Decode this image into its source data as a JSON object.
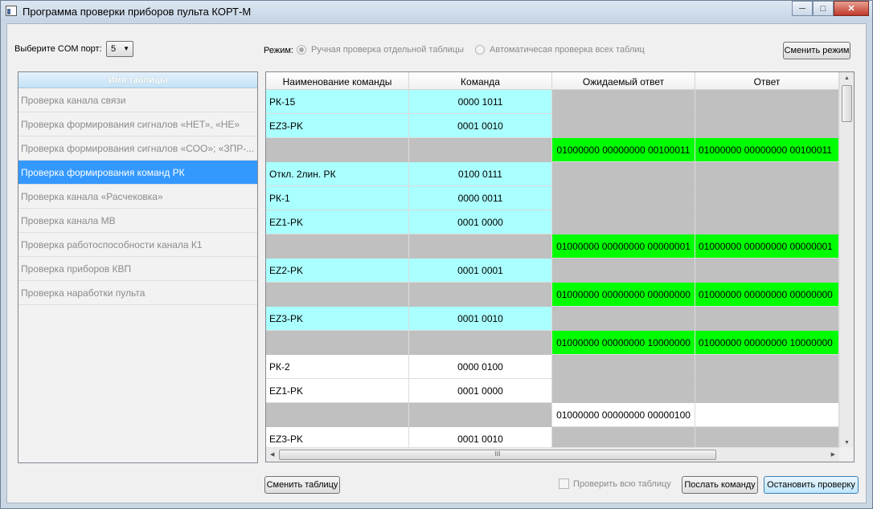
{
  "window": {
    "title": "Программа проверки приборов пульта КОРТ-М"
  },
  "com": {
    "label": "Выберите COM порт:",
    "value": "5"
  },
  "mode": {
    "label": "Режим:",
    "manual": "Ручная проверка отдельной таблицы",
    "auto": "Автоматичесая проверка всех таблиц",
    "selected": "manual"
  },
  "buttons": {
    "switch_mode": "Сменить режим",
    "switch_table": "Сменить таблицу",
    "send_command": "Послать команду",
    "stop_check": "Остановить проверку"
  },
  "check_all": {
    "label": "Проверить всю таблицу",
    "checked": false
  },
  "tables": {
    "header": "Имя таблицы",
    "items": [
      {
        "label": "Проверка канала связи"
      },
      {
        "label": "Проверка формирования сигналов «НЕТ», «НЕ»"
      },
      {
        "label": "Проверка формирования сигналов «СОО»; «ЗПР-..."
      },
      {
        "label": "Проверка формирования команд РК",
        "selected": true
      },
      {
        "label": "Проверка канала «Расчековка»"
      },
      {
        "label": "Проверка канала МВ"
      },
      {
        "label": "Проверка работоспособности канала К1"
      },
      {
        "label": "Проверка приборов КВП"
      },
      {
        "label": "Проверка наработки пульта"
      }
    ]
  },
  "grid": {
    "columns": [
      "Наименование команды",
      "Команда",
      "Ожидаемый ответ",
      "Ответ"
    ],
    "rows": [
      {
        "name": "РК-15",
        "cmd": "0000 1011",
        "expected": "",
        "answer": "",
        "style": "cmd"
      },
      {
        "name": "EZ3-PK",
        "cmd": "0001 0010",
        "expected": "",
        "answer": "",
        "style": "cmd"
      },
      {
        "name": "",
        "cmd": "",
        "expected": "01000000  00000000  00100011",
        "answer": "01000000  00000000  00100011",
        "style": "resp"
      },
      {
        "name": "Откл. 2лин. РК",
        "cmd": "0100 0111",
        "expected": "",
        "answer": "",
        "style": "cmd"
      },
      {
        "name": "РК-1",
        "cmd": "0000 0011",
        "expected": "",
        "answer": "",
        "style": "cmd"
      },
      {
        "name": "EZ1-PK",
        "cmd": "0001 0000",
        "expected": "",
        "answer": "",
        "style": "cmd"
      },
      {
        "name": "",
        "cmd": "",
        "expected": "01000000  00000000  00000001",
        "answer": "01000000  00000000  00000001",
        "style": "resp"
      },
      {
        "name": "EZ2-PK",
        "cmd": "0001 0001",
        "expected": "",
        "answer": "",
        "style": "cmd"
      },
      {
        "name": "",
        "cmd": "",
        "expected": "01000000  00000000  00000000",
        "answer": "01000000  00000000  00000000",
        "style": "resp"
      },
      {
        "name": "EZ3-PK",
        "cmd": "0001 0010",
        "expected": "",
        "answer": "",
        "style": "cmd"
      },
      {
        "name": "",
        "cmd": "",
        "expected": "01000000  00000000  10000000",
        "answer": "01000000  00000000  10000000",
        "style": "resp"
      },
      {
        "name": "РК-2",
        "cmd": "0000 0100",
        "expected": "",
        "answer": "",
        "style": "pending"
      },
      {
        "name": "EZ1-PK",
        "cmd": "0001 0000",
        "expected": "",
        "answer": "",
        "style": "pending"
      },
      {
        "name": "",
        "cmd": "",
        "expected": "01000000  00000000  00000100",
        "answer": "",
        "style": "presp"
      },
      {
        "name": "EZ3-PK",
        "cmd": "0001 0010",
        "expected": "",
        "answer": "",
        "style": "pending"
      }
    ],
    "hscroll_glyph": "III"
  },
  "colors": {
    "command_row": "#aaffff",
    "response_row": "#c0c0c0",
    "matched_answer": "#00ff00",
    "selected_item": "#3399ff"
  }
}
